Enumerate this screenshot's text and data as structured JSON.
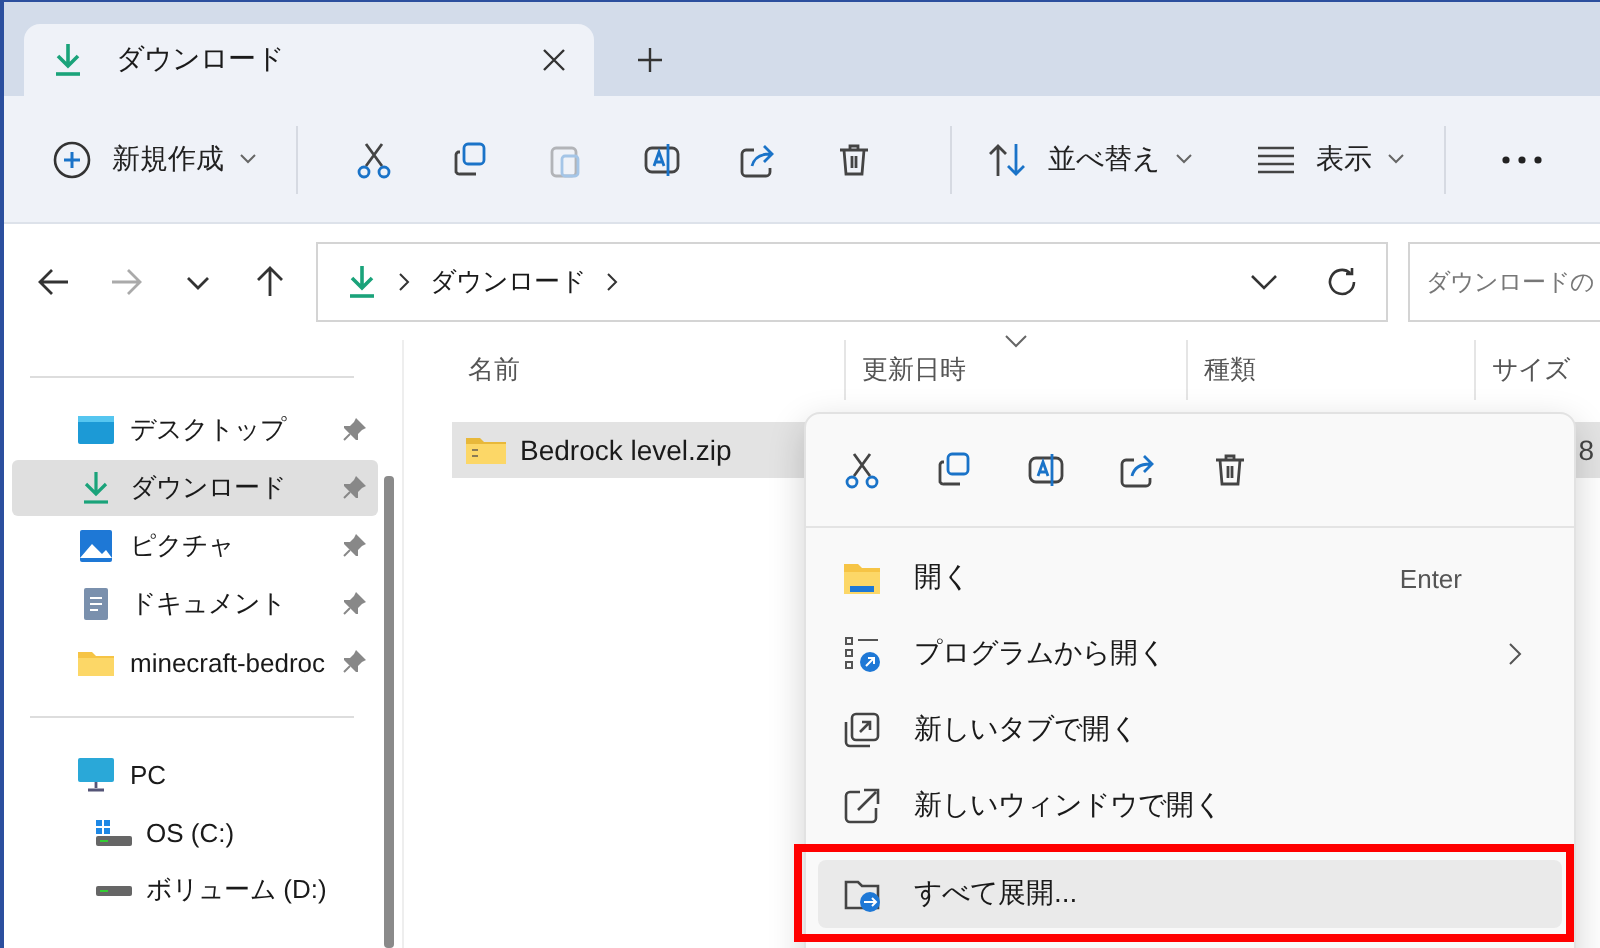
{
  "tab": {
    "title": "ダウンロード"
  },
  "toolbar": {
    "new_label": "新規作成",
    "actions": [
      {
        "kind": "cut",
        "disabled": false
      },
      {
        "kind": "copy",
        "disabled": false
      },
      {
        "kind": "paste",
        "disabled": true
      },
      {
        "kind": "rename",
        "disabled": false
      },
      {
        "kind": "share",
        "disabled": false
      },
      {
        "kind": "delete",
        "disabled": false
      }
    ],
    "sort_label": "並べ替え",
    "view_label": "表示"
  },
  "nav": [
    {
      "kind": "back",
      "disabled": false
    },
    {
      "kind": "forward",
      "disabled": true
    },
    {
      "kind": "recent",
      "disabled": false
    },
    {
      "kind": "up",
      "disabled": false
    }
  ],
  "address": {
    "segments": [
      "ダウンロード"
    ]
  },
  "search": {
    "placeholder": "ダウンロードの"
  },
  "sidebar": {
    "quick_access": [
      {
        "label": "デスクトップ",
        "kind": "desktop",
        "pinned": true,
        "selected": false
      },
      {
        "label": "ダウンロード",
        "kind": "download",
        "pinned": true,
        "selected": true
      },
      {
        "label": "ピクチャ",
        "kind": "pictures",
        "pinned": true,
        "selected": false
      },
      {
        "label": "ドキュメント",
        "kind": "documents",
        "pinned": true,
        "selected": false
      },
      {
        "label": "minecraft-bedroc",
        "kind": "folder",
        "pinned": true,
        "selected": false
      }
    ],
    "tree": [
      {
        "label": "PC",
        "kind": "pc",
        "children": [
          {
            "label": "OS (C:)",
            "kind": "osdrive"
          },
          {
            "label": "ボリューム (D:)",
            "kind": "drive"
          }
        ]
      }
    ]
  },
  "table": {
    "columns": [
      {
        "label": "名前",
        "sorted": false
      },
      {
        "label": "更新日時",
        "sorted": true
      },
      {
        "label": "種類",
        "sorted": false
      },
      {
        "label": "サイズ",
        "sorted": false
      }
    ],
    "rows": [
      {
        "name": "Bedrock level.zip",
        "size": "8",
        "selected": true
      }
    ]
  },
  "context_menu": {
    "actions": [
      {
        "kind": "cut"
      },
      {
        "kind": "copy"
      },
      {
        "kind": "rename"
      },
      {
        "kind": "share"
      },
      {
        "kind": "delete"
      }
    ],
    "items": [
      {
        "kind": "open",
        "label": "開く",
        "shortcut": "Enter",
        "submenu": false,
        "selected": false,
        "marked": false
      },
      {
        "kind": "openwith",
        "label": "プログラムから開く",
        "submenu": true,
        "selected": false,
        "marked": false
      },
      {
        "kind": "newtab",
        "label": "新しいタブで開く",
        "submenu": false,
        "selected": false,
        "marked": false
      },
      {
        "kind": "newwindow",
        "label": "新しいウィンドウで開く",
        "submenu": false,
        "selected": false,
        "marked": false
      },
      {
        "kind": "extract",
        "label": "すべて展開...",
        "submenu": false,
        "selected": true,
        "marked": true
      }
    ]
  }
}
